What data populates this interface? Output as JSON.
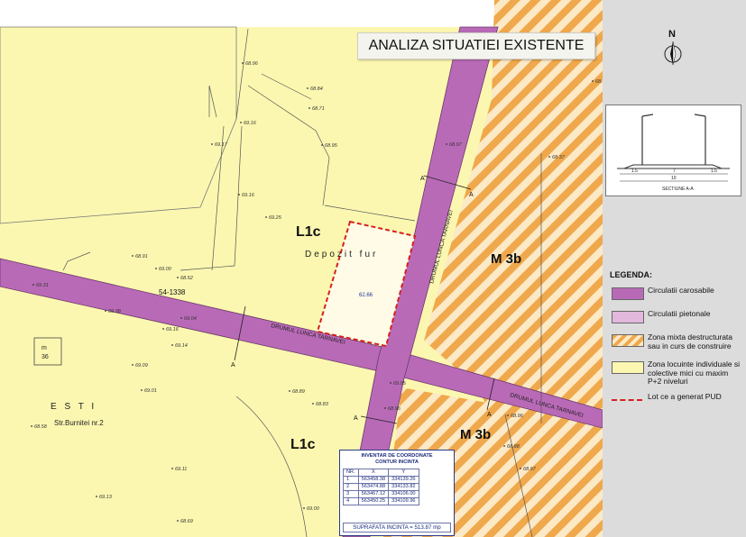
{
  "title": "ANALIZA SITUATIEI EXISTENTE",
  "north_label": "N",
  "zone_labels": {
    "l1c_top": "L1c",
    "l1c_bottom": "L1c",
    "m3b_right": "M 3b",
    "m3b_bottom": "M 3b"
  },
  "map_texts": {
    "depozit": "Depozit fur",
    "lot_value": "62.66",
    "parcel_code": "54-1338",
    "street_main": "DRUMUL LUNCA TARNAVEI",
    "street_right": "DRUMUL LUNCA TARNAVEI",
    "street_vertical": "DRUMUL LUNCA TARNAVEI",
    "street_burnitei": "Str.Burnitei nr.2",
    "estii": "E S T I",
    "mm_label": "m\n36",
    "cut_a": "A",
    "elevations": [
      "68.96",
      "68.84",
      "68.71",
      "68.37",
      "69.16",
      "68.95",
      "68.90",
      "68.97",
      "69.17",
      "69.16",
      "69.25",
      "68.91",
      "68.52",
      "69.00",
      "69.31",
      "69.38",
      "69.16",
      "69.04",
      "69.14",
      "69.09",
      "69.01",
      "69.05",
      "68.96",
      "68.96",
      "68.88",
      "68.83",
      "68.89",
      "68.97",
      "68.58",
      "69.11",
      "69.13",
      "69.00",
      "68.57",
      "68.69"
    ]
  },
  "section": {
    "caption": "SECTIUNE A-A",
    "dims": [
      "1.5",
      "7",
      "1.5",
      "10"
    ]
  },
  "legend": {
    "title": "LEGENDA:",
    "items": [
      {
        "swatch": "carosabile",
        "label": "Circulatii carosabile"
      },
      {
        "swatch": "pietonale",
        "label": "Circulatii pietonale"
      },
      {
        "swatch": "mixta",
        "label": "Zona mixta destructurata sau in curs de construire"
      },
      {
        "swatch": "locuinte",
        "label": "Zona locuinte individuale si colective mici cu maxim P+2 niveluri"
      },
      {
        "swatch": "lot",
        "label": "Lot ce a generat PUD"
      }
    ]
  },
  "inventory": {
    "title_line1": "INVENTAR DE COORDONATE",
    "title_line2": "CONTUR INCINTA",
    "headers": [
      "NR.",
      "X",
      "Y"
    ],
    "rows": [
      [
        "1",
        "563458.38",
        "334139.26"
      ],
      [
        "2",
        "563474.88",
        "334133.82"
      ],
      [
        "3",
        "563467.12",
        "334106.00"
      ],
      [
        "4",
        "563450.25",
        "334109.96"
      ]
    ],
    "surface_label": "SUPRAFATA INCINTA = 513.87 mp"
  },
  "colors": {
    "road": "#b96ab7",
    "residential": "#fbf7b0",
    "mixed_a": "#f0a84c",
    "mixed_b": "#fce9c6",
    "lot_outline": "#d52020"
  }
}
